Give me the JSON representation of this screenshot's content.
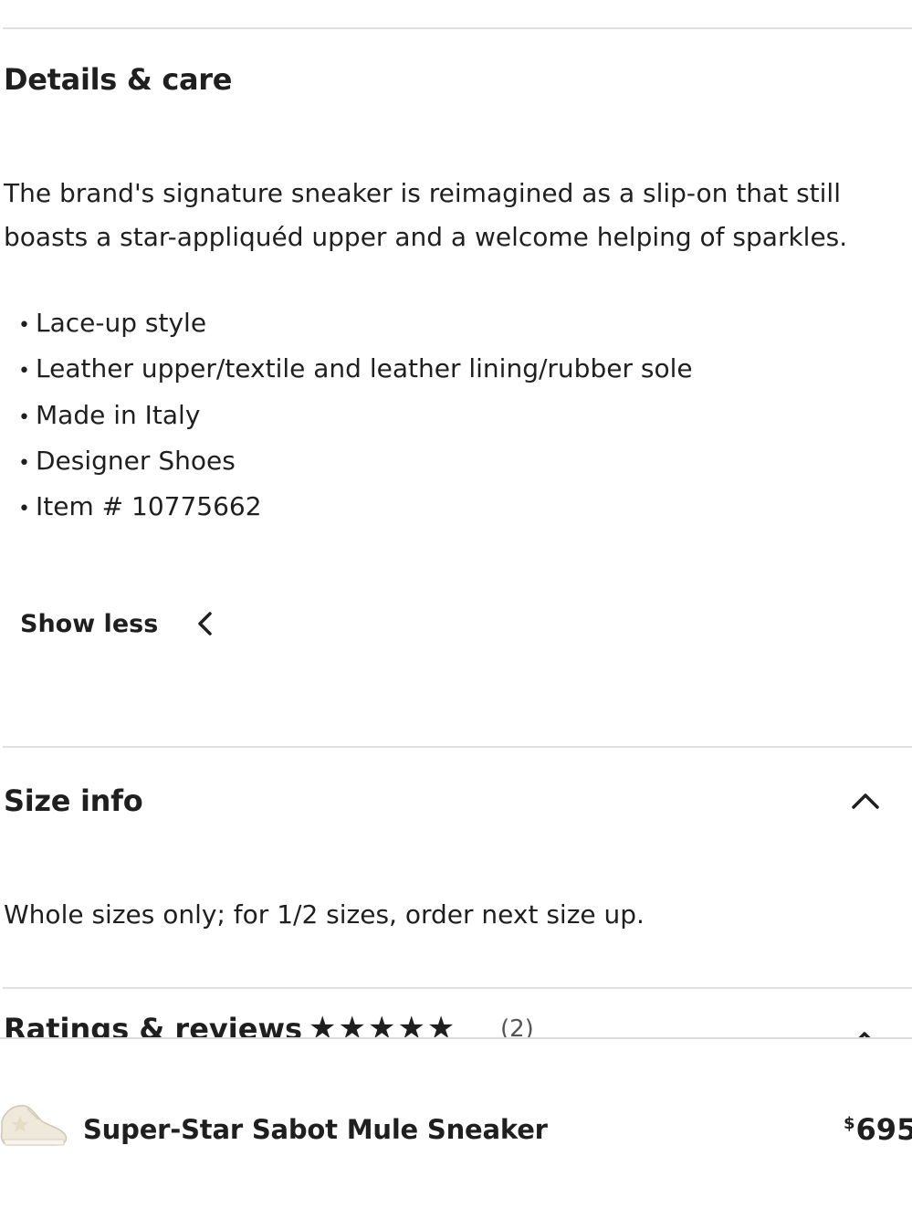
{
  "details": {
    "title": "Details & care",
    "description": "The brand's signature sneaker is reimagined as a slip-on that still boasts a star-appliquéd upper and a welcome helping of sparkles.",
    "bullets": [
      "Lace-up style",
      "Leather upper/textile and leather lining/rubber sole",
      "Made in Italy",
      "Designer Shoes",
      "Item # 10775662"
    ],
    "toggle_label": "Show less"
  },
  "size_info": {
    "title": "Size info",
    "text": "Whole sizes only; for 1/2 sizes, order next size up."
  },
  "ratings": {
    "title": "Ratings & reviews",
    "stars": "★★★★★",
    "count": "(2)"
  },
  "sticky_bar": {
    "product_name": "Super-Star Sabot Mule Sneaker",
    "currency": "$",
    "price": "695"
  },
  "icons": {
    "show_less": "chevron-left-icon",
    "size_info_toggle": "chevron-up-icon",
    "ratings_toggle": "chevron-up-icon",
    "thumbnail": "sneaker-thumbnail"
  },
  "colors": {
    "text": "#1f1f1f",
    "divider": "#e1e1e1",
    "background": "#ffffff"
  }
}
